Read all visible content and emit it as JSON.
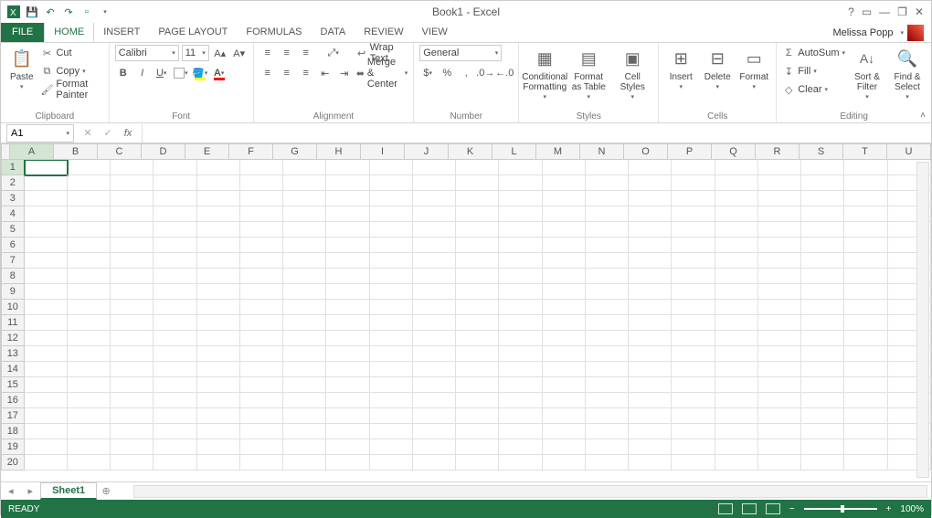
{
  "title": "Book1 - Excel",
  "user_name": "Melissa Popp",
  "tabs": {
    "file": "FILE",
    "items": [
      "HOME",
      "INSERT",
      "PAGE LAYOUT",
      "FORMULAS",
      "DATA",
      "REVIEW",
      "VIEW"
    ],
    "active": "HOME"
  },
  "ribbon": {
    "clipboard": {
      "label": "Clipboard",
      "paste": "Paste",
      "cut": "Cut",
      "copy": "Copy",
      "format_painter": "Format Painter"
    },
    "font": {
      "label": "Font",
      "name": "Calibri",
      "size": "11"
    },
    "alignment": {
      "label": "Alignment",
      "wrap": "Wrap Text",
      "merge": "Merge & Center"
    },
    "number": {
      "label": "Number",
      "format": "General"
    },
    "styles": {
      "label": "Styles",
      "cond": "Conditional Formatting",
      "table": "Format as Table",
      "cell": "Cell Styles"
    },
    "cells": {
      "label": "Cells",
      "insert": "Insert",
      "delete": "Delete",
      "format": "Format"
    },
    "editing": {
      "label": "Editing",
      "autosum": "AutoSum",
      "fill": "Fill",
      "clear": "Clear",
      "sort": "Sort & Filter",
      "find": "Find & Select"
    }
  },
  "name_box": "A1",
  "columns": [
    "A",
    "B",
    "C",
    "D",
    "E",
    "F",
    "G",
    "H",
    "I",
    "J",
    "K",
    "L",
    "M",
    "N",
    "O",
    "P",
    "Q",
    "R",
    "S",
    "T",
    "U"
  ],
  "rows": [
    1,
    2,
    3,
    4,
    5,
    6,
    7,
    8,
    9,
    10,
    11,
    12,
    13,
    14,
    15,
    16,
    17,
    18,
    19,
    20
  ],
  "active_cell": "A1",
  "sheet_tab": "Sheet1",
  "status_text": "READY",
  "zoom": "100%"
}
